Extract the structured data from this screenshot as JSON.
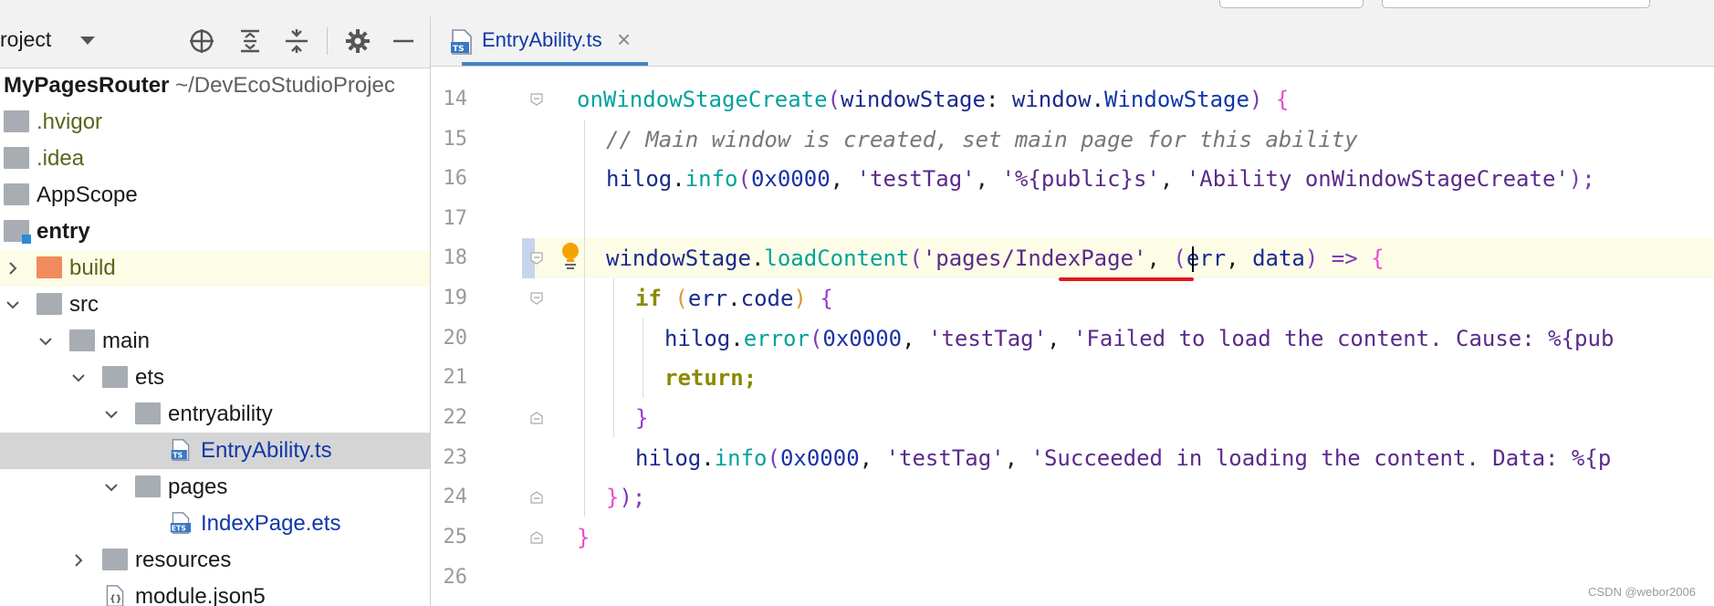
{
  "colors": {
    "accent": "#4083c9",
    "selected_row": "#d5d5d5",
    "highlight_row": "#fcfce7",
    "underline": "#e11b1b"
  },
  "panel": {
    "title": "roject",
    "toolbar_icons": [
      "crosshair-icon",
      "expand-all-icon",
      "collapse-all-icon",
      "gear-icon",
      "minimize-icon"
    ]
  },
  "tree": [
    {
      "label": "MyPagesRouter",
      "path": "~/DevEcoStudioProjec"
    },
    {
      "label": ".hvigor"
    },
    {
      "label": ".idea"
    },
    {
      "label": "AppScope"
    },
    {
      "label": "entry"
    },
    {
      "label": "build"
    },
    {
      "label": "src"
    },
    {
      "label": "main"
    },
    {
      "label": "ets"
    },
    {
      "label": "entryability"
    },
    {
      "label": "EntryAbility.ts"
    },
    {
      "label": "pages"
    },
    {
      "label": "IndexPage.ets"
    },
    {
      "label": "resources"
    },
    {
      "label": "module.json5"
    }
  ],
  "editor": {
    "tab": {
      "label": "EntryAbility.ts",
      "icon": "ts-file-icon",
      "close": "×"
    },
    "line_numbers": [
      "14",
      "15",
      "16",
      "17",
      "18",
      "19",
      "20",
      "21",
      "22",
      "23",
      "24",
      "25",
      "26"
    ],
    "code": {
      "l14": {
        "a": "onWindowStageCreate",
        "b": "(",
        "c": "windowStage",
        "d": ": ",
        "e": "window",
        "f": ".",
        "g": "WindowStage",
        "h": ") ",
        "i": "{"
      },
      "l15": {
        "a": "// Main window is created, set main page for this ability"
      },
      "l16": {
        "a": "hilog",
        "b": ".",
        "c": "info",
        "d": "(",
        "e": "0x0000",
        "f": ", ",
        "g": "'testTag'",
        "h": ", ",
        "i": "'%{public}s'",
        "j": ", ",
        "k": "'Ability onWindowStageCreate'",
        "l": ");"
      },
      "l18": {
        "a": "windowStage",
        "b": ".",
        "c": "loadContent",
        "d": "(",
        "e": "'pages/IndexPage'",
        "f": ", ",
        "g": "(",
        "h": "err",
        "i": ", ",
        "j": "data",
        "k": ") => ",
        "l": "{"
      },
      "l19": {
        "a": "if ",
        "b": "(",
        "c": "err",
        "d": ".",
        "e": "code",
        "f": ") ",
        "g": "{"
      },
      "l20": {
        "a": "hilog",
        "b": ".",
        "c": "error",
        "d": "(",
        "e": "0x0000",
        "f": ", ",
        "g": "'testTag'",
        "h": ", ",
        "i": "'Failed to load the content. Cause: %{pub"
      },
      "l21": {
        "a": "return",
        "b": ";"
      },
      "l22": {
        "a": "}"
      },
      "l23": {
        "a": "hilog",
        "b": ".",
        "c": "info",
        "d": "(",
        "e": "0x0000",
        "f": ", ",
        "g": "'testTag'",
        "h": ", ",
        "i": "'Succeeded in loading the content. Data: %{p"
      },
      "l24": {
        "a": "}",
        "b": ");"
      },
      "l25": {
        "a": "}"
      }
    }
  },
  "watermark": "CSDN @webor2006"
}
